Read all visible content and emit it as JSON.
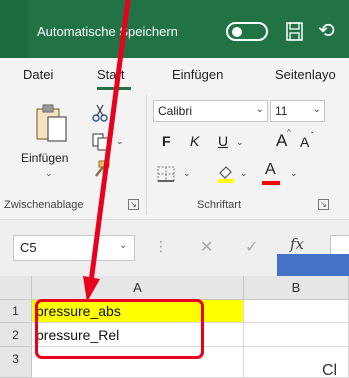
{
  "titlebar": {
    "autosave_label": "Automatische Speichern",
    "toggle_state": "off",
    "bg_color": "#217346"
  },
  "tabs": {
    "items": [
      "Datei",
      "Start",
      "Einfügen",
      "Seitenlayo"
    ],
    "active": "Start"
  },
  "ribbon": {
    "clipboard": {
      "paste_label": "Einfügen",
      "group_label": "Zwischenablage",
      "icons": [
        "paste-icon",
        "cut-icon",
        "copy-icon",
        "format-painter-icon"
      ]
    },
    "font": {
      "font_name": "Calibri",
      "font_size": "11",
      "bold": "F",
      "italic": "K",
      "underline": "U",
      "grow": "A",
      "shrink": "A",
      "font_color_letter": "A",
      "group_label": "Schriftart",
      "fill_color": "#ffff00",
      "font_color": "#ff0000"
    }
  },
  "formula_bar": {
    "name_box": "C5",
    "fx": "fx"
  },
  "grid": {
    "columns": [
      "A",
      "B"
    ],
    "rows": [
      {
        "num": "1",
        "a": "pressure_abs",
        "a_fill": "#ffff00"
      },
      {
        "num": "2",
        "a": "pressure_Rel",
        "a_fill": "#ffffff"
      },
      {
        "num": "3",
        "a": "",
        "a_fill": "#ffffff"
      }
    ],
    "cropped_text": "Cl"
  },
  "annotation": {
    "highlight_color": "#e8001c"
  }
}
